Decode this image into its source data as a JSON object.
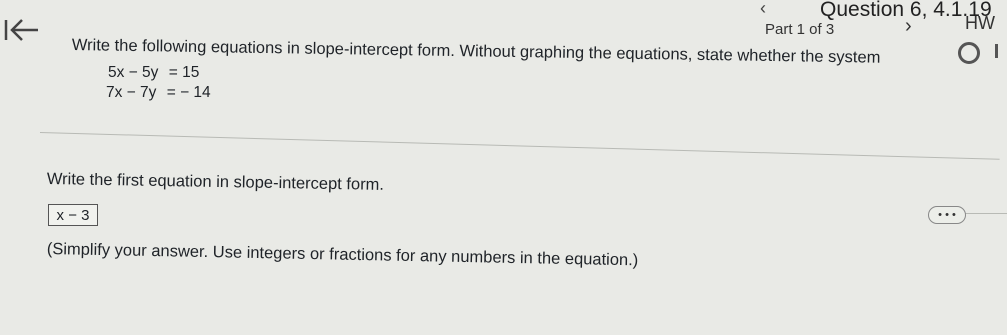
{
  "header": {
    "question_title": "Question 6, 4.1.19",
    "part_label": "Part 1 of 3",
    "prev_symbol": "‹",
    "next_symbol": "›",
    "hw_label": "HW"
  },
  "problem": {
    "instructions": "Write the following equations in slope-intercept form. Without graphing the equations, state whether the system",
    "equations": [
      {
        "lhs": "5x − 5y",
        "rhs": "= 15"
      },
      {
        "lhs": "7x − 7y",
        "rhs": "= − 14"
      }
    ]
  },
  "part1": {
    "prompt": "Write the first equation in slope-intercept form.",
    "answer_value": "x − 3",
    "hint": "(Simplify your answer. Use integers or fractions for any numbers in the equation.)",
    "more_label": "• • •"
  }
}
